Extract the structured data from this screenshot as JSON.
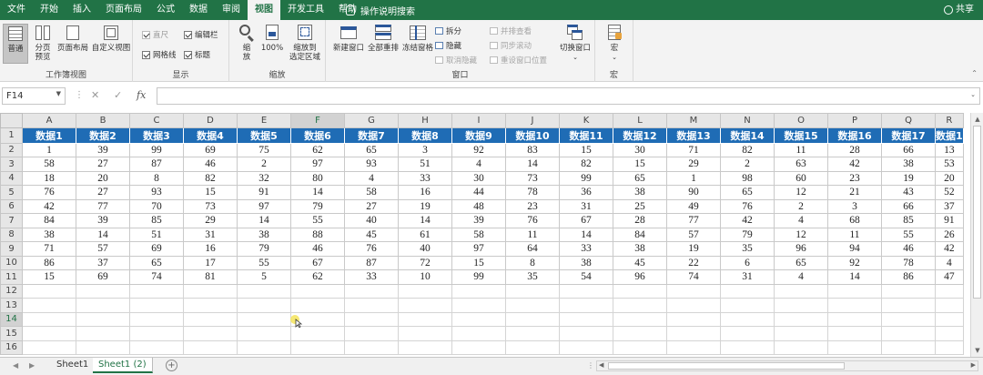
{
  "menu": {
    "tabs": [
      "文件",
      "开始",
      "插入",
      "页面布局",
      "公式",
      "数据",
      "审阅",
      "视图",
      "开发工具",
      "帮助"
    ],
    "active_tab": "视图",
    "tell_me": "操作说明搜索",
    "share": "共享"
  },
  "ribbon": {
    "workbook_views": {
      "label": "工作簿视图",
      "normal": "普通",
      "page_break_line1": "分页",
      "page_break_line2": "预览",
      "page_layout": "页面布局",
      "custom_views": "自定义视图"
    },
    "show": {
      "label": "显示",
      "ruler": "直尺",
      "formula_bar": "编辑栏",
      "gridlines": "网格线",
      "headings": "标题"
    },
    "zoom": {
      "label": "缩放",
      "zoom_line1": "缩",
      "zoom_line2": "放",
      "zoom100": "100%",
      "zoom_sel_line1": "缩放到",
      "zoom_sel_line2": "选定区域"
    },
    "window": {
      "label": "窗口",
      "new_window": "新建窗口",
      "arrange_all": "全部重排",
      "freeze_panes": "冻结窗格",
      "split": "拆分",
      "hide": "隐藏",
      "unhide": "取消隐藏",
      "side_by_side": "并排查看",
      "sync_scroll": "同步滚动",
      "reset_position": "重设窗口位置",
      "switch_windows": "切换窗口"
    },
    "macros": {
      "label": "宏",
      "macros": "宏"
    }
  },
  "formula_bar": {
    "name_box": "F14",
    "cancel": "✕",
    "enter": "✓",
    "fx": "fx",
    "value": ""
  },
  "sheet": {
    "columns": [
      "A",
      "B",
      "C",
      "D",
      "E",
      "F",
      "G",
      "H",
      "I",
      "J",
      "K",
      "L",
      "M",
      "N",
      "O",
      "P",
      "Q",
      "R"
    ],
    "selected_column": "F",
    "selected_row": "14",
    "row_numbers": [
      "1",
      "2",
      "3",
      "4",
      "5",
      "6",
      "7",
      "8",
      "9",
      "10",
      "11",
      "12",
      "13",
      "14",
      "15",
      "16"
    ],
    "headers": [
      "数据1",
      "数据2",
      "数据3",
      "数据4",
      "数据5",
      "数据6",
      "数据7",
      "数据8",
      "数据9",
      "数据10",
      "数据11",
      "数据12",
      "数据13",
      "数据14",
      "数据15",
      "数据16",
      "数据17",
      "数据1"
    ],
    "rows": [
      [
        "1",
        "39",
        "99",
        "69",
        "75",
        "62",
        "65",
        "3",
        "92",
        "83",
        "15",
        "30",
        "71",
        "82",
        "11",
        "28",
        "66",
        "13"
      ],
      [
        "58",
        "27",
        "87",
        "46",
        "2",
        "97",
        "93",
        "51",
        "4",
        "14",
        "82",
        "15",
        "29",
        "2",
        "63",
        "42",
        "38",
        "53"
      ],
      [
        "18",
        "20",
        "8",
        "82",
        "32",
        "80",
        "4",
        "33",
        "30",
        "73",
        "99",
        "65",
        "1",
        "98",
        "60",
        "23",
        "19",
        "20"
      ],
      [
        "76",
        "27",
        "93",
        "15",
        "91",
        "14",
        "58",
        "16",
        "44",
        "78",
        "36",
        "38",
        "90",
        "65",
        "12",
        "21",
        "43",
        "52"
      ],
      [
        "42",
        "77",
        "70",
        "73",
        "97",
        "79",
        "27",
        "19",
        "48",
        "23",
        "31",
        "25",
        "49",
        "76",
        "2",
        "3",
        "66",
        "37"
      ],
      [
        "84",
        "39",
        "85",
        "29",
        "14",
        "55",
        "40",
        "14",
        "39",
        "76",
        "67",
        "28",
        "77",
        "42",
        "4",
        "68",
        "85",
        "91"
      ],
      [
        "38",
        "14",
        "51",
        "31",
        "38",
        "88",
        "45",
        "61",
        "58",
        "11",
        "14",
        "84",
        "57",
        "79",
        "12",
        "11",
        "55",
        "26"
      ],
      [
        "71",
        "57",
        "69",
        "16",
        "79",
        "46",
        "76",
        "40",
        "97",
        "64",
        "33",
        "38",
        "19",
        "35",
        "96",
        "94",
        "46",
        "42"
      ],
      [
        "86",
        "37",
        "65",
        "17",
        "55",
        "67",
        "87",
        "72",
        "15",
        "8",
        "38",
        "45",
        "22",
        "6",
        "65",
        "92",
        "78",
        "4"
      ],
      [
        "15",
        "69",
        "74",
        "81",
        "5",
        "62",
        "33",
        "10",
        "99",
        "35",
        "54",
        "96",
        "74",
        "31",
        "4",
        "14",
        "86",
        "47"
      ]
    ]
  },
  "sheet_tabs": {
    "tabs": [
      "Sheet1",
      "Sheet1 (2)"
    ],
    "active": "Sheet1 (2)",
    "add": "+"
  },
  "colors": {
    "brand": "#217346",
    "header_fill": "#1f6cb5"
  }
}
